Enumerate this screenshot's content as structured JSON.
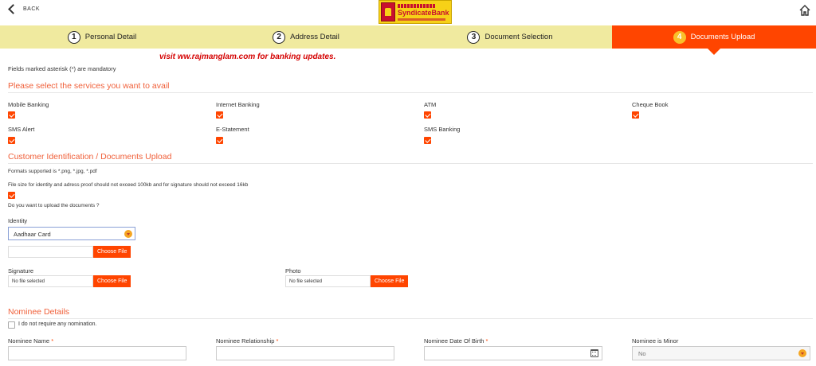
{
  "header": {
    "back_label": "BACK",
    "logo_name": "SyndicateBank",
    "brand_color": "#f7d117"
  },
  "steps": [
    {
      "num": "1",
      "label": "Personal Detail",
      "active": false
    },
    {
      "num": "2",
      "label": "Address Detail",
      "active": false
    },
    {
      "num": "3",
      "label": "Document Selection",
      "active": false
    },
    {
      "num": "4",
      "label": "Documents Upload",
      "active": true
    }
  ],
  "watermark": "visit ww.rajmanglam.com for banking updates.",
  "mandatory_note": "Fields marked asterisk (*) are mandatory",
  "services": {
    "title": "Please select the services you want to avail",
    "items": [
      {
        "label": "Mobile Banking",
        "checked": true
      },
      {
        "label": "Internet Banking",
        "checked": true
      },
      {
        "label": "ATM",
        "checked": true
      },
      {
        "label": "Cheque Book",
        "checked": true
      },
      {
        "label": "SMS Alert",
        "checked": true
      },
      {
        "label": "E-Statement",
        "checked": true
      },
      {
        "label": "SMS Banking",
        "checked": true
      }
    ]
  },
  "documents": {
    "title": "Customer Identification / Documents Upload",
    "formats": "Formats supported is *.png, *.jpg, *.pdf",
    "size_note": "File size for identity and adress proof should not exceed 100kb and for signature should not exceed 16kb",
    "upload_question": "Do you want to upload the documents ?",
    "identity_label": "Identity",
    "identity_value": "Aadhaar Card",
    "choose_file": "Choose File",
    "no_file": "No file selected",
    "signature_label": "Signature",
    "photo_label": "Photo"
  },
  "nominee": {
    "title": "Nominee Details",
    "no_nomination": "I do not require any nomination.",
    "name_label": "Nominee Name",
    "relationship_label": "Nominee Relationship",
    "dob_label": "Nominee Date Of Birth",
    "minor_label": "Nominee is Minor",
    "minor_value": "No",
    "required_mark": "*"
  },
  "colors": {
    "accent": "#ff4500",
    "step_bar": "#f0ea9f",
    "section_title": "#f0603a",
    "watermark": "#d40000"
  }
}
